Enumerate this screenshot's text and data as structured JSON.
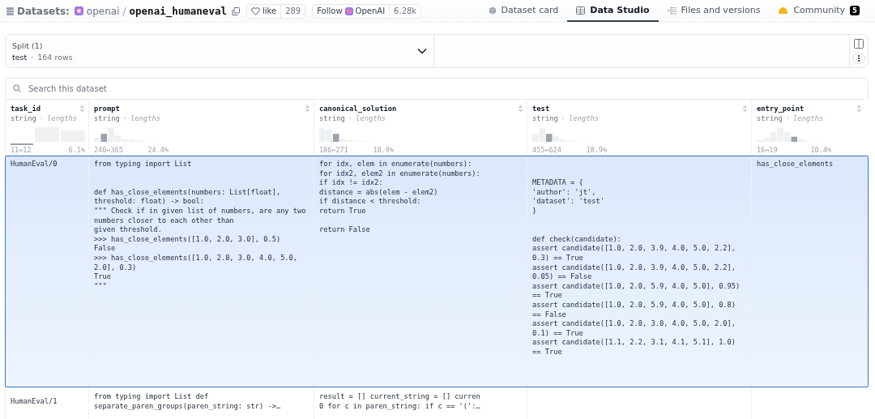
{
  "header": {
    "section": "Datasets:",
    "owner": "openai",
    "separator": "/",
    "repo": "openai_humaneval",
    "like_button": {
      "label": "like",
      "count": "289"
    },
    "follow_button": {
      "label": "Follow",
      "org": "OpenAI",
      "count": "6.28k"
    },
    "tabs": [
      {
        "label": "Dataset card",
        "kind": "card",
        "selected": false
      },
      {
        "label": "Data Studio",
        "kind": "table",
        "selected": true
      },
      {
        "label": "Files and versions",
        "kind": "files",
        "selected": false
      },
      {
        "label": "Community",
        "kind": "community",
        "selected": false,
        "badge": "5"
      }
    ]
  },
  "split": {
    "label": "Split (1)",
    "value": "test",
    "dot": "·",
    "rows": "164 rows"
  },
  "search": {
    "placeholder": "Search this dataset"
  },
  "table": {
    "columns": [
      {
        "name": "task_id",
        "type": "string",
        "dot": "·",
        "stat": "lengths",
        "range": "11↔12",
        "percent": "6.1%"
      },
      {
        "name": "prompt",
        "type": "string",
        "dot": "·",
        "stat": "lengths",
        "range": "240↔365",
        "percent": "24.4%"
      },
      {
        "name": "canonical_solution",
        "type": "string",
        "dot": "·",
        "stat": "lengths",
        "range": "186↔271",
        "percent": "18.9%"
      },
      {
        "name": "test",
        "type": "string",
        "dot": "·",
        "stat": "lengths",
        "range": "455↔624",
        "percent": "18.9%"
      },
      {
        "name": "entry_point",
        "type": "string",
        "dot": "·",
        "stat": "lengths",
        "range": "16↔19",
        "percent": "10.4%"
      }
    ],
    "rows": [
      {
        "selected": true,
        "cells": [
          "HumanEval/0",
          "from typing import List\n\n\ndef has_close_elements(numbers: List[float],\nthreshold: float) -> bool:\n\"\"\" Check if in given list of numbers, are any two\nnumbers closer to each other than\ngiven threshold.\n>>> has_close_elements([1.0, 2.0, 3.0], 0.5)\nFalse\n>>> has_close_elements([1.0, 2.8, 3.0, 4.0, 5.0,\n2.0], 0.3)\nTrue\n\"\"\"",
          "for idx, elem in enumerate(numbers):\nfor idx2, elem2 in enumerate(numbers):\nif idx != idx2:\ndistance = abs(elem - elem2)\nif distance < threshold:\nreturn True\n\nreturn False",
          "\n\nMETADATA = {\n'author': 'jt',\n'dataset': 'test'\n}\n\n\ndef check(candidate):\nassert candidate([1.0, 2.0, 3.9, 4.0, 5.0, 2.2],\n0.3) == True\nassert candidate([1.0, 2.0, 3.9, 4.0, 5.0, 2.2],\n0.05) == False\nassert candidate([1.0, 2.0, 5.9, 4.0, 5.0], 0.95)\n== True\nassert candidate([1.0, 2.0, 5.9, 4.0, 5.0], 0.8)\n== False\nassert candidate([1.0, 2.0, 3.0, 4.0, 5.0, 2.0],\n0.1) == True\nassert candidate([1.1, 2.2, 3.1, 4.1, 5.1], 1.0)\n== True",
          "has_close_elements"
        ]
      },
      {
        "selected": false,
        "cells": [
          "HumanEval/1",
          "from typing import List def\nseparate_paren_groups(paren_string: str) ->…",
          "result = [] current_string = [] curren\n0 for c in paren_string: if c == '(':…"
        ]
      }
    ]
  }
}
